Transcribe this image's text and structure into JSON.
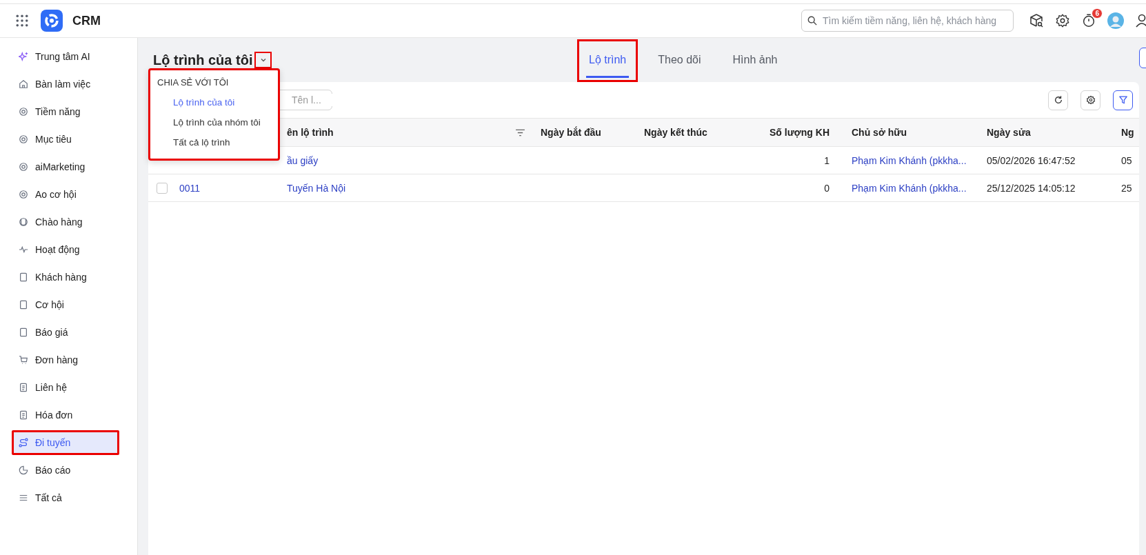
{
  "app": {
    "title": "CRM"
  },
  "search": {
    "placeholder": "Tìm kiếm tiềm năng, liên hệ, khách hàng"
  },
  "notifications": {
    "badge": "6"
  },
  "sidebar": {
    "items": [
      {
        "label": "Trung tâm AI",
        "selected": false,
        "highlighted": false
      },
      {
        "label": "Bàn làm việc",
        "selected": false,
        "highlighted": false
      },
      {
        "label": "Tiềm năng",
        "selected": false,
        "highlighted": false
      },
      {
        "label": "Mục tiêu",
        "selected": false,
        "highlighted": false
      },
      {
        "label": "aiMarketing",
        "selected": false,
        "highlighted": false
      },
      {
        "label": "Ao cơ hội",
        "selected": false,
        "highlighted": false
      },
      {
        "label": "Chào hàng",
        "selected": false,
        "highlighted": false
      },
      {
        "label": "Hoạt động",
        "selected": false,
        "highlighted": false
      },
      {
        "label": "Khách hàng",
        "selected": false,
        "highlighted": false
      },
      {
        "label": "Cơ hội",
        "selected": false,
        "highlighted": false
      },
      {
        "label": "Báo giá",
        "selected": false,
        "highlighted": false
      },
      {
        "label": "Đơn hàng",
        "selected": false,
        "highlighted": false
      },
      {
        "label": "Liên hệ",
        "selected": false,
        "highlighted": false
      },
      {
        "label": "Hóa đơn",
        "selected": false,
        "highlighted": false
      },
      {
        "label": "Đi tuyến",
        "selected": true,
        "highlighted": true
      },
      {
        "label": "Báo cáo",
        "selected": false,
        "highlighted": false
      },
      {
        "label": "Tất cả",
        "selected": false,
        "highlighted": false
      }
    ]
  },
  "view": {
    "title": "Lộ trình của tôi",
    "chevron_highlighted": true
  },
  "view_menu": {
    "highlighted": true,
    "heading": "CHIA SẺ VỚI TÔI",
    "items": [
      {
        "label": "Lộ trình của tôi",
        "selected": true
      },
      {
        "label": "Lộ trình của nhóm tôi",
        "selected": false
      },
      {
        "label": "Tất cả lộ trình",
        "selected": false
      }
    ]
  },
  "tabs": [
    {
      "label": "Lộ trình",
      "selected": true,
      "highlighted": true
    },
    {
      "label": "Theo dõi",
      "selected": false,
      "highlighted": false
    },
    {
      "label": "Hình ảnh",
      "selected": false,
      "highlighted": false
    }
  ],
  "table": {
    "search_placeholder": "Tên l...",
    "columns": [
      "",
      "ên lộ trình",
      "Ngày bắt đầu",
      "Ngày kết thúc",
      "Số lượng KH",
      "Chủ sở hữu",
      "Ngày sửa",
      "Ng"
    ],
    "rows": [
      {
        "cells": [
          "",
          "ầu giấy",
          "",
          "",
          "1",
          "Phạm Kim Khánh (pkkha...",
          "05/02/2026 16:47:52",
          "05"
        ]
      },
      {
        "checked": false,
        "cells": [
          "0011",
          "Tuyến Hà Nội",
          "",
          "",
          "0",
          "Phạm Kim Khánh (pkkha...",
          "25/12/2025 14:05:12",
          "25"
        ]
      }
    ]
  }
}
